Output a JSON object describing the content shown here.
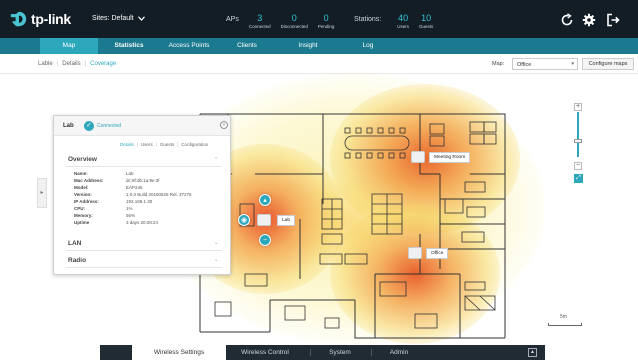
{
  "header": {
    "brand": "tp-link",
    "site_label": "Sites: Default",
    "aps": {
      "label": "APs",
      "connected": {
        "value": "3",
        "label": "Connected"
      },
      "disconnected": {
        "value": "0",
        "label": "Disconnected"
      },
      "pending": {
        "value": "0",
        "label": "Pending"
      }
    },
    "stations": {
      "label": "Stations:",
      "users": {
        "value": "40",
        "label": "Users"
      },
      "guests": {
        "value": "10",
        "label": "Guests"
      }
    },
    "icons": [
      "refresh-icon",
      "settings-icon",
      "logout-icon"
    ]
  },
  "nav": {
    "items": [
      "Map",
      "Statistics",
      "Access Points",
      "Clients",
      "Insight",
      "Log"
    ],
    "active": "Map"
  },
  "subbar": {
    "tabs": [
      "Lable",
      "Details",
      "Coverage"
    ],
    "active": "Coverage",
    "map_label": "Map:",
    "map_value": "Office",
    "configure_label": "Configure maps"
  },
  "panel": {
    "name": "Lab",
    "status": "Connected",
    "tabs": [
      "Details",
      "Users",
      "Guests",
      "Configuration"
    ],
    "active_tab": "Details",
    "overview_title": "Overview",
    "fields": [
      {
        "k": "Name:",
        "v": "Lab"
      },
      {
        "k": "Mac Address:",
        "v": "dc:9f:db:1a:9e:3f"
      },
      {
        "k": "Model:",
        "v": "EAP245"
      },
      {
        "k": "Version:",
        "v": "1.0.0 Build 20160525 Rel. 37276"
      },
      {
        "k": "IP Address:",
        "v": "192.168.1.30"
      },
      {
        "k": "CPU:",
        "v": "1%"
      },
      {
        "k": "Memory:",
        "v": "56%"
      },
      {
        "k": "Uptime",
        "v": "3 days 20:28:24"
      }
    ],
    "lan_title": "LAN",
    "radio_title": "Radio"
  },
  "aps_on_map": [
    {
      "label": "Meeting Room"
    },
    {
      "label": "Lab"
    },
    {
      "label": "Office"
    }
  ],
  "scale": {
    "label": "5m"
  },
  "bottom": {
    "tabs": [
      "Wireless Settings",
      "Wireless Control",
      "System",
      "Admin"
    ],
    "active": "Wireless Settings"
  },
  "colors": {
    "topbar": "#121d26",
    "nav": "#1b7a8f",
    "accent": "#2ca7bb",
    "stat_number": "#36c3d4"
  }
}
